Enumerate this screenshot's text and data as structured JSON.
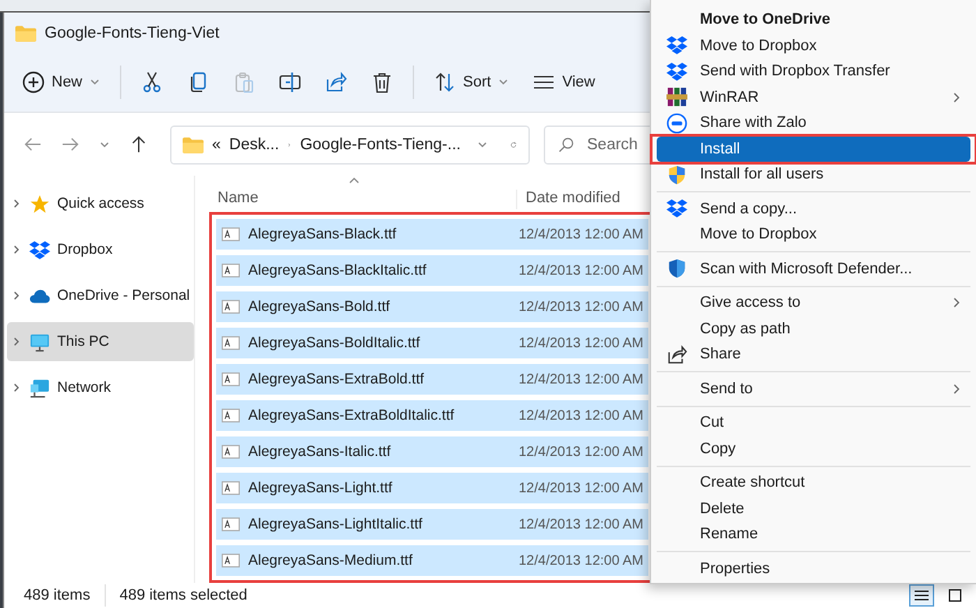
{
  "window": {
    "title": "Google-Fonts-Tieng-Viet"
  },
  "toolbar": [
    {
      "kind": "new",
      "label": "New",
      "disabled": false
    },
    {
      "kind": "cut",
      "disabled": false
    },
    {
      "kind": "copy",
      "disabled": false
    },
    {
      "kind": "paste",
      "disabled": true
    },
    {
      "kind": "rename",
      "disabled": false
    },
    {
      "kind": "share",
      "disabled": false
    },
    {
      "kind": "delete",
      "disabled": false
    },
    {
      "kind": "sort",
      "label": "Sort",
      "disabled": false
    },
    {
      "kind": "view",
      "label": "View",
      "disabled": false
    }
  ],
  "address": {
    "overflow_mark": "«",
    "segments": [
      "Desk...",
      "Google-Fonts-Tieng-..."
    ]
  },
  "search": {
    "placeholder": "Search"
  },
  "sidebar": [
    {
      "label": "Quick access",
      "kind": "star",
      "selected": false
    },
    {
      "label": "Dropbox",
      "kind": "dropbox",
      "selected": false
    },
    {
      "label": "OneDrive - Personal",
      "kind": "cloud",
      "selected": false
    },
    {
      "label": "This PC",
      "kind": "pc",
      "selected": true
    },
    {
      "label": "Network",
      "kind": "network",
      "selected": false
    }
  ],
  "file_list": {
    "columns": [
      "Name",
      "Date modified"
    ],
    "outlined": true,
    "rows": [
      {
        "name": "AlegreyaSans-Black.ttf",
        "date": "12/4/2013 12:00 AM",
        "selected": true
      },
      {
        "name": "AlegreyaSans-BlackItalic.ttf",
        "date": "12/4/2013 12:00 AM",
        "selected": true
      },
      {
        "name": "AlegreyaSans-Bold.ttf",
        "date": "12/4/2013 12:00 AM",
        "selected": true
      },
      {
        "name": "AlegreyaSans-BoldItalic.ttf",
        "date": "12/4/2013 12:00 AM",
        "selected": true
      },
      {
        "name": "AlegreyaSans-ExtraBold.ttf",
        "date": "12/4/2013 12:00 AM",
        "selected": true
      },
      {
        "name": "AlegreyaSans-ExtraBoldItalic.ttf",
        "date": "12/4/2013 12:00 AM",
        "selected": true
      },
      {
        "name": "AlegreyaSans-Italic.ttf",
        "date": "12/4/2013 12:00 AM",
        "selected": true
      },
      {
        "name": "AlegreyaSans-Light.ttf",
        "date": "12/4/2013 12:00 AM",
        "selected": true
      },
      {
        "name": "AlegreyaSans-LightItalic.ttf",
        "date": "12/4/2013 12:00 AM",
        "selected": true
      },
      {
        "name": "AlegreyaSans-Medium.ttf",
        "date": "12/4/2013 12:00 AM",
        "selected": true
      }
    ]
  },
  "status_bar": {
    "texts": [
      "489 items",
      "489 items selected"
    ],
    "view_buttons": [
      {
        "kind": "details",
        "selected": true
      },
      {
        "kind": "tiles",
        "selected": false
      }
    ]
  },
  "context_menu": [
    {
      "kind": "plain",
      "label": "Move to OneDrive",
      "bold": true,
      "submenu": false,
      "selected": false,
      "outlined": false
    },
    {
      "kind": "dropbox",
      "label": "Move to Dropbox",
      "bold": false,
      "submenu": false,
      "selected": false,
      "outlined": false
    },
    {
      "kind": "dropbox",
      "label": "Send with Dropbox Transfer",
      "bold": false,
      "submenu": false,
      "selected": false,
      "outlined": false
    },
    {
      "kind": "winrar",
      "label": "WinRAR",
      "bold": false,
      "submenu": true,
      "selected": false,
      "outlined": false
    },
    {
      "kind": "zalo",
      "label": "Share with Zalo",
      "bold": false,
      "submenu": false,
      "selected": false,
      "outlined": false
    },
    {
      "kind": "plain",
      "label": "Install",
      "bold": false,
      "submenu": false,
      "selected": true,
      "outlined": true
    },
    {
      "kind": "shield",
      "label": "Install for all users",
      "bold": false,
      "submenu": false,
      "selected": false,
      "outlined": false
    },
    {
      "kind": "separator"
    },
    {
      "kind": "dropbox",
      "label": "Send a copy...",
      "bold": false,
      "submenu": false,
      "selected": false,
      "outlined": false
    },
    {
      "kind": "plain",
      "label": "Move to Dropbox",
      "bold": false,
      "submenu": false,
      "selected": false,
      "outlined": false
    },
    {
      "kind": "separator"
    },
    {
      "kind": "defender",
      "label": "Scan with Microsoft Defender...",
      "bold": false,
      "submenu": false,
      "selected": false,
      "outlined": false
    },
    {
      "kind": "separator"
    },
    {
      "kind": "plain",
      "label": "Give access to",
      "bold": false,
      "submenu": true,
      "selected": false,
      "outlined": false
    },
    {
      "kind": "plain",
      "label": "Copy as path",
      "bold": false,
      "submenu": false,
      "selected": false,
      "outlined": false
    },
    {
      "kind": "share",
      "label": "Share",
      "bold": false,
      "submenu": false,
      "selected": false,
      "outlined": false
    },
    {
      "kind": "separator"
    },
    {
      "kind": "plain",
      "label": "Send to",
      "bold": false,
      "submenu": true,
      "selected": false,
      "outlined": false
    },
    {
      "kind": "separator"
    },
    {
      "kind": "plain",
      "label": "Cut",
      "bold": false,
      "submenu": false,
      "selected": false,
      "outlined": false
    },
    {
      "kind": "plain",
      "label": "Copy",
      "bold": false,
      "submenu": false,
      "selected": false,
      "outlined": false
    },
    {
      "kind": "separator"
    },
    {
      "kind": "plain",
      "label": "Create shortcut",
      "bold": false,
      "submenu": false,
      "selected": false,
      "outlined": false
    },
    {
      "kind": "plain",
      "label": "Delete",
      "bold": false,
      "submenu": false,
      "selected": false,
      "outlined": false
    },
    {
      "kind": "plain",
      "label": "Rename",
      "bold": false,
      "submenu": false,
      "selected": false,
      "outlined": false
    },
    {
      "kind": "separator"
    },
    {
      "kind": "plain",
      "label": "Properties",
      "bold": false,
      "submenu": false,
      "selected": false,
      "outlined": false
    }
  ]
}
